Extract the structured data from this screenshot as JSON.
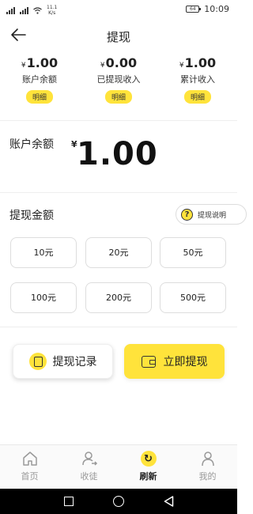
{
  "status_bar": {
    "signal_1": "⁴⁶",
    "signal_2": "⁴⁶",
    "speed": "11.1",
    "speed_unit": "K/s",
    "battery": "64",
    "time": "10:09"
  },
  "header": {
    "title": "提现"
  },
  "summary": [
    {
      "currency": "¥",
      "value": "1.00",
      "label": "账户余额",
      "detail": "明细"
    },
    {
      "currency": "¥",
      "value": "0.00",
      "label": "已提现收入",
      "detail": "明细"
    },
    {
      "currency": "¥",
      "value": "1.00",
      "label": "累计收入",
      "detail": "明细"
    }
  ],
  "balance": {
    "label": "账户余额",
    "currency": "¥",
    "value": "1.00"
  },
  "amount": {
    "label": "提现金额",
    "explain": "提现说明",
    "explain_icon": "?",
    "options": [
      "10元",
      "20元",
      "50元",
      "100元",
      "200元",
      "500元"
    ]
  },
  "actions": {
    "record": "提现记录",
    "withdraw": "立即提现"
  },
  "tabs": [
    {
      "label": "首页",
      "icon": "home-icon"
    },
    {
      "label": "收徒",
      "icon": "add-user-icon"
    },
    {
      "label": "刷新",
      "icon": "refresh-icon"
    },
    {
      "label": "我的",
      "icon": "user-icon"
    }
  ],
  "colors": {
    "accent": "#ffe33b",
    "text": "#222222",
    "muted": "#999999"
  }
}
